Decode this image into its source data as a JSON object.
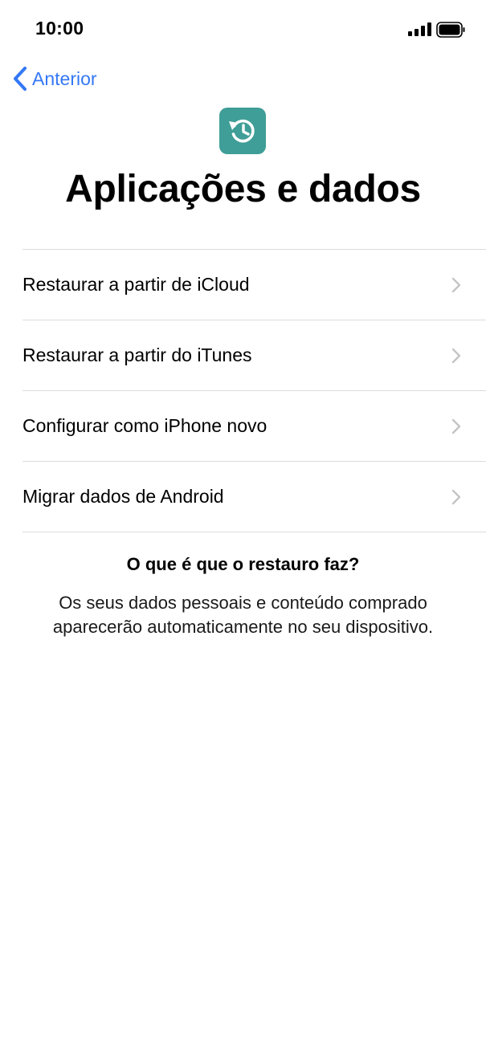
{
  "status_bar": {
    "time": "10:00",
    "icons": [
      "signal-icon",
      "battery-icon"
    ]
  },
  "nav": {
    "back_label": "Anterior",
    "back_icon": "chevron-left-icon"
  },
  "header": {
    "icon": "restore-icon",
    "title": "Aplicações e dados"
  },
  "options": [
    {
      "label": "Restaurar a partir de iCloud"
    },
    {
      "label": "Restaurar a partir do iTunes"
    },
    {
      "label": "Configurar como iPhone novo"
    },
    {
      "label": "Migrar dados de Android"
    }
  ],
  "info": {
    "heading": "O que é que o restauro faz?",
    "body": "Os seus dados pessoais e conteúdo comprado aparecerão automaticamente no seu dispositivo."
  },
  "colors": {
    "accent": "#3478f6",
    "icon_background": "#3f9e97",
    "separator": "#dcdcdf",
    "chevron": "#c4c4c7"
  }
}
